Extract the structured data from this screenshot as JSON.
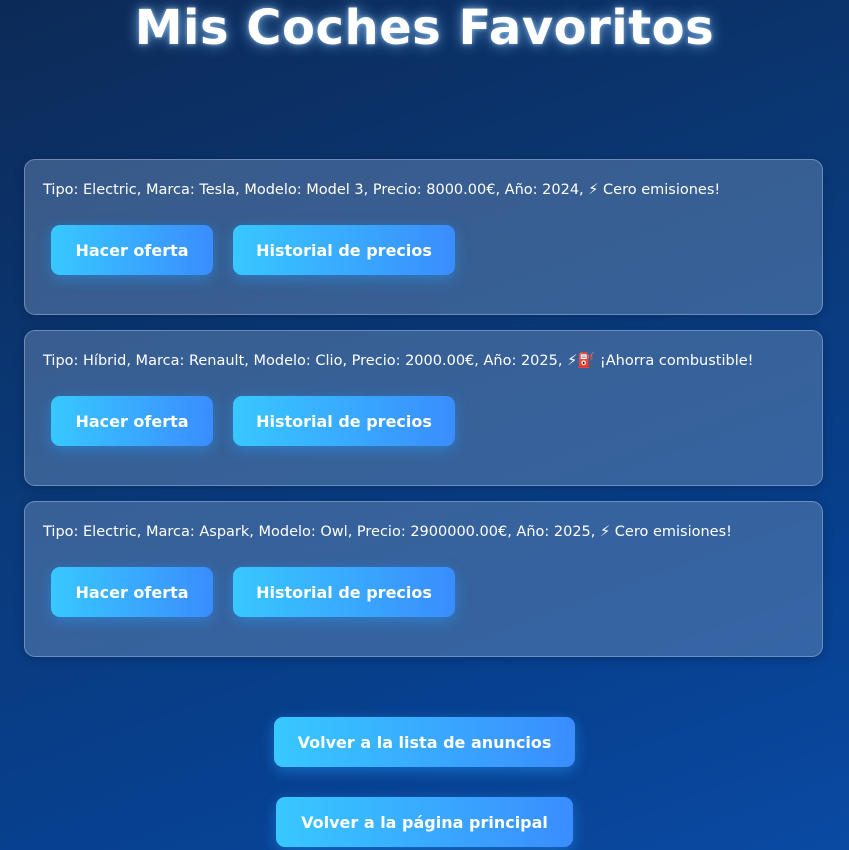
{
  "page": {
    "title": "Mis Coches Favoritos"
  },
  "cars": [
    {
      "description": "Tipo: Electric, Marca: Tesla, Modelo: Model 3, Precio: 8000.00€, Año: 2024, ⚡ Cero emisiones!",
      "offer_label": "Hacer oferta",
      "history_label": "Historial de precios"
    },
    {
      "description": "Tipo: Híbrid, Marca: Renault, Modelo: Clio, Precio: 2000.00€, Año: 2025, ⚡⛽ ¡Ahorra combustible!",
      "offer_label": "Hacer oferta",
      "history_label": "Historial de precios"
    },
    {
      "description": "Tipo: Electric, Marca: Aspark, Modelo: Owl, Precio: 2900000.00€, Año: 2025, ⚡ Cero emisiones!",
      "offer_label": "Hacer oferta",
      "history_label": "Historial de precios"
    }
  ],
  "navigation": {
    "back_to_list_label": "Volver a la lista de anuncios",
    "back_to_home_label": "Volver a la página principal"
  },
  "colors": {
    "button_gradient_start": "#38c8ff",
    "button_gradient_end": "#3a8dff",
    "background": "#0a3a7a"
  }
}
